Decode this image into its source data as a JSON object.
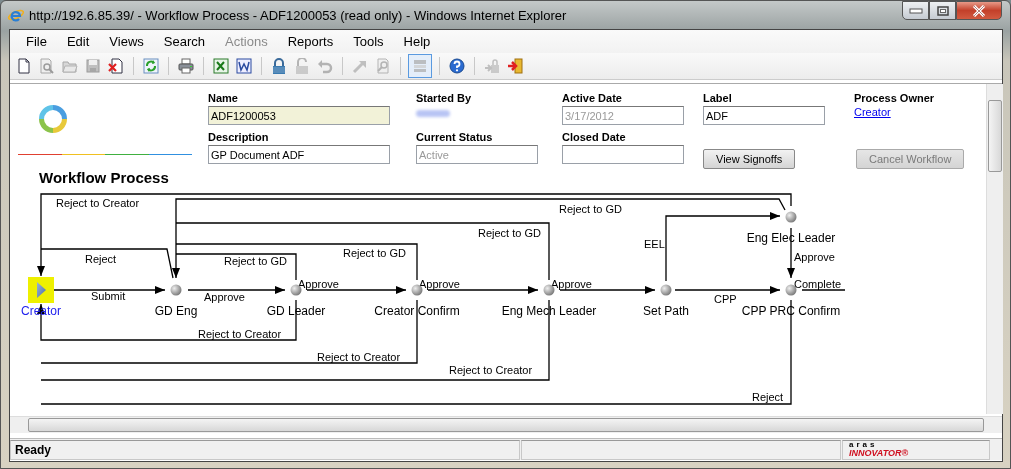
{
  "window": {
    "title": "http://192.6.85.39/ - Workflow Process - ADF1200053 (read only) - Windows Internet Explorer"
  },
  "menu": [
    {
      "label": "File",
      "disabled": false
    },
    {
      "label": "Edit",
      "disabled": false
    },
    {
      "label": "Views",
      "disabled": false
    },
    {
      "label": "Search",
      "disabled": false
    },
    {
      "label": "Actions",
      "disabled": true
    },
    {
      "label": "Reports",
      "disabled": false
    },
    {
      "label": "Tools",
      "disabled": false
    },
    {
      "label": "Help",
      "disabled": false
    }
  ],
  "toolbar": [
    {
      "disabled": false,
      "selected": false
    },
    {
      "disabled": true,
      "selected": false
    },
    {
      "disabled": true,
      "selected": false
    },
    {
      "disabled": true,
      "selected": false
    },
    {
      "disabled": false,
      "selected": false
    },
    {
      "disabled": false,
      "selected": false
    },
    {
      "disabled": false,
      "selected": false
    },
    {
      "disabled": false,
      "selected": false
    },
    {
      "disabled": false,
      "selected": false
    },
    {
      "disabled": false,
      "selected": false
    },
    {
      "disabled": true,
      "selected": false
    },
    {
      "disabled": true,
      "selected": false
    },
    {
      "disabled": true,
      "selected": false
    },
    {
      "disabled": true,
      "selected": false
    },
    {
      "disabled": true,
      "selected": true
    },
    {
      "disabled": false,
      "selected": false
    },
    {
      "disabled": true,
      "selected": false
    },
    {
      "disabled": false,
      "selected": false
    }
  ],
  "form": {
    "title": "Workflow Process",
    "fields": [
      {
        "kind": "input",
        "label": "Name",
        "value": "ADF1200053",
        "readonly": false,
        "highlighted": true
      },
      {
        "kind": "blurred",
        "label": "Started By"
      },
      {
        "kind": "input",
        "label": "Active Date",
        "value": "3/17/2012",
        "readonly": true,
        "highlighted": false
      },
      {
        "kind": "input",
        "label": "Label",
        "value": "ADF",
        "readonly": false,
        "highlighted": false
      },
      {
        "kind": "link",
        "label": "Process Owner",
        "value": "Creator"
      },
      {
        "kind": "input",
        "label": "Description",
        "value": "GP Document ADF",
        "readonly": false,
        "highlighted": false
      },
      {
        "kind": "input",
        "label": "Current Status",
        "value": "Active",
        "readonly": true,
        "highlighted": false
      },
      {
        "kind": "input",
        "label": "Closed Date"
      },
      {
        "kind": "button",
        "label": "View Signoffs",
        "disabled": false
      },
      {
        "kind": "button",
        "label": "Cancel Workflow",
        "disabled": true
      }
    ]
  },
  "diagram": {
    "nodes": [
      {
        "kind": "activity",
        "label": "Eng Elec Leader"
      },
      {
        "kind": "start",
        "label": "Creator"
      },
      {
        "kind": "activity",
        "label": "GD Eng"
      },
      {
        "kind": "activity",
        "label": "GD Leader"
      },
      {
        "kind": "activity",
        "label": "Creator Confirm"
      },
      {
        "kind": "activity",
        "label": "Eng Mech Leader"
      },
      {
        "kind": "activity",
        "label": "Set Path"
      },
      {
        "kind": "activity",
        "label": "CPP PRC Confirm"
      }
    ],
    "edges": [
      {
        "kind": "arrow",
        "label": "Reject to Creator"
      },
      {
        "kind": "arrow",
        "label": "Reject to GD"
      },
      {
        "kind": "line",
        "label": "Reject to GD"
      },
      {
        "kind": "arrow",
        "label": "EEL"
      },
      {
        "kind": "line",
        "label": "Reject"
      },
      {
        "kind": "line",
        "label": "Reject to GD"
      },
      {
        "kind": "line",
        "label": "Reject to GD"
      },
      {
        "kind": "arrow",
        "label": "Approve"
      },
      {
        "kind": "arrow",
        "label": "Submit"
      },
      {
        "kind": "arrow",
        "label": "Approve"
      },
      {
        "kind": "arrow",
        "label": "Approve"
      },
      {
        "kind": "arrow",
        "label": "Approve"
      },
      {
        "kind": "arrow",
        "label": "Approve"
      },
      {
        "kind": "arrow",
        "label": "CPP"
      },
      {
        "kind": "line",
        "label": "Complete"
      },
      {
        "kind": "arrow",
        "label": "Reject to Creator"
      },
      {
        "kind": "line",
        "label": "Reject to Creator"
      },
      {
        "kind": "line",
        "label": "Reject to Creator"
      },
      {
        "kind": "line",
        "label": "Reject"
      }
    ]
  },
  "status_bar": {
    "text": "Ready",
    "logo_top": "aras",
    "logo_bottom": "INNOVATOR®"
  }
}
